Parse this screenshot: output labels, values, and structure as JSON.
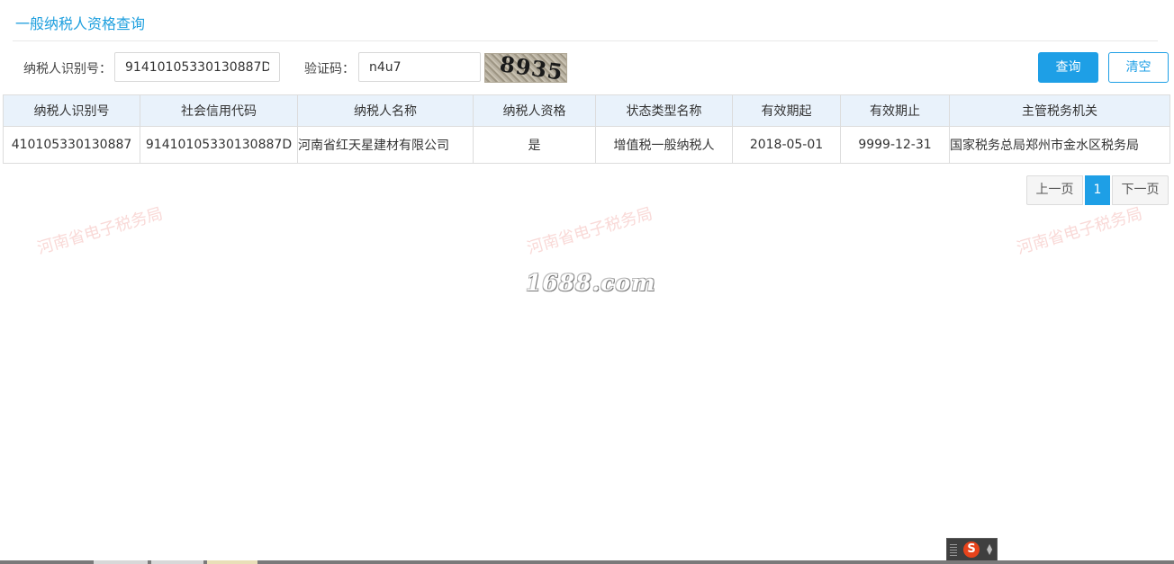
{
  "page": {
    "title": "一般纳税人资格查询"
  },
  "search": {
    "taxpayer_id_label": "纳税人识别号：",
    "taxpayer_id_value": "91410105330130887D",
    "captcha_label": "验证码：",
    "captcha_value": "n4u7",
    "captcha_image_text": "8935",
    "query_button": "查询",
    "clear_button": "清空"
  },
  "table": {
    "columns": [
      "纳税人识别号",
      "社会信用代码",
      "纳税人名称",
      "纳税人资格",
      "状态类型名称",
      "有效期起",
      "有效期止",
      "主管税务机关"
    ],
    "rows": [
      [
        "410105330130887",
        "91410105330130887D",
        "河南省红天星建材有限公司",
        "是",
        "增值税一般纳税人",
        "2018-05-01",
        "9999-12-31",
        "国家税务总局郑州市金水区税务局"
      ]
    ]
  },
  "pagination": {
    "prev": "上一页",
    "current": "1",
    "next": "下一页"
  },
  "watermarks": [
    "河南省电子税务局",
    "河南省电子税务局",
    "河南省电子税务局"
  ],
  "overlay_logo": "1688.com",
  "ime": {
    "logo": "S"
  },
  "colors": {
    "accent": "#1e9fe6",
    "header_bg": "#e9f2fb"
  }
}
